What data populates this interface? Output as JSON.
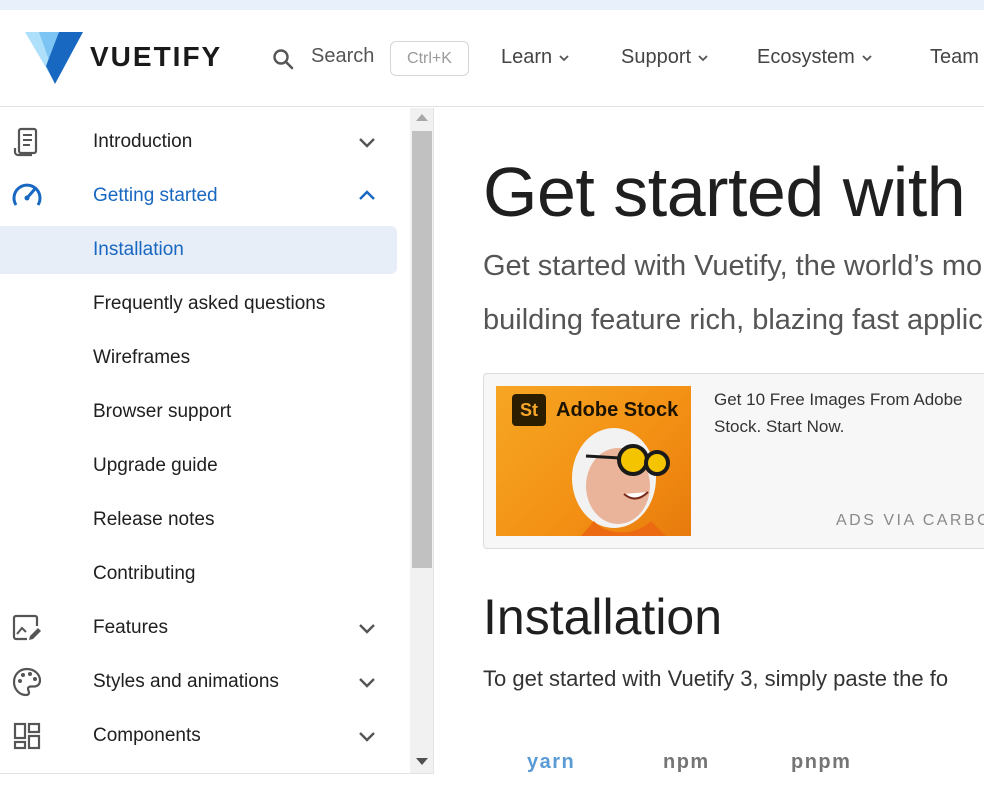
{
  "brand": {
    "name": "VUETIFY",
    "logo_icon": "vuetify-logo-icon"
  },
  "search": {
    "label": "Search",
    "shortcut": "Ctrl+K",
    "icon": "search-icon"
  },
  "nav": {
    "items": [
      {
        "label": "Learn"
      },
      {
        "label": "Support"
      },
      {
        "label": "Ecosystem"
      },
      {
        "label": "Team"
      }
    ]
  },
  "sidebar": {
    "items": [
      {
        "label": "Introduction",
        "icon": "scroll-text-icon",
        "chevron": "down"
      },
      {
        "label": "Getting started",
        "icon": "speedometer-icon",
        "chevron": "up"
      },
      {
        "label": "Installation"
      },
      {
        "label": "Frequently asked questions"
      },
      {
        "label": "Wireframes"
      },
      {
        "label": "Browser support"
      },
      {
        "label": "Upgrade guide"
      },
      {
        "label": "Release notes"
      },
      {
        "label": "Contributing"
      },
      {
        "label": "Features",
        "icon": "image-edit-icon",
        "chevron": "down"
      },
      {
        "label": "Styles and animations",
        "icon": "palette-icon",
        "chevron": "down"
      },
      {
        "label": "Components",
        "icon": "view-dashboard-icon",
        "chevron": "down"
      }
    ]
  },
  "main": {
    "title": "Get started with",
    "lead_line1": "Get started with Vuetify, the world’s mo",
    "lead_line2": "building feature rich, blazing fast applic",
    "ad": {
      "badge": "St",
      "brand": "Adobe Stock",
      "text": "Get 10 Free Images From Adobe Stock. Start Now.",
      "via": "ADS VIA CARBO"
    },
    "section_title": "Installation",
    "section_text": "To get started with Vuetify 3, simply paste the fo",
    "tabs": [
      {
        "label": "yarn",
        "active": true
      },
      {
        "label": "npm",
        "active": false
      },
      {
        "label": "pnpm",
        "active": false
      }
    ]
  },
  "colors": {
    "accent": "#1867c0",
    "selected_bg": "#e7eef8",
    "logo_light": "#7cc4f4",
    "logo_dark": "#1867c0"
  }
}
